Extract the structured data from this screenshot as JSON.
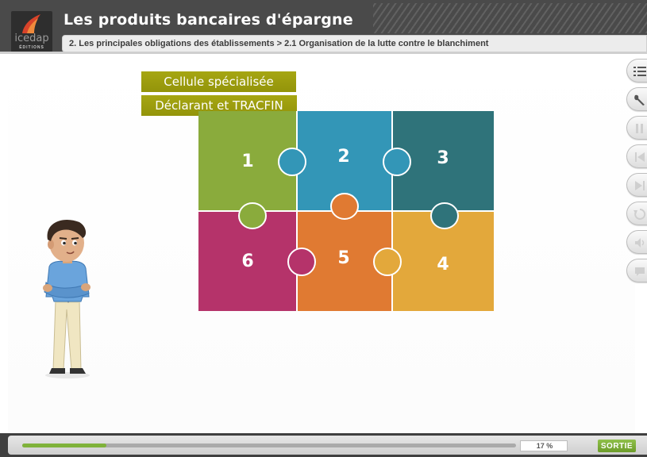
{
  "header": {
    "title": "Les produits bancaires d'épargne",
    "breadcrumb": "2. Les principales obligations des établissements > 2.1 Organisation de la lutte contre le blanchiment"
  },
  "logo": {
    "text": "icedap",
    "subtext": "ÉDITIONS"
  },
  "labels": [
    {
      "text": "Cellule spécialisée"
    },
    {
      "text": "Déclarant et TRACFIN"
    }
  ],
  "puzzle": {
    "pieces": [
      {
        "number": "1",
        "color": "#8aab3c"
      },
      {
        "number": "2",
        "color": "#3396b7"
      },
      {
        "number": "3",
        "color": "#2f737a"
      },
      {
        "number": "6",
        "color": "#b5336a"
      },
      {
        "number": "5",
        "color": "#e07a32"
      },
      {
        "number": "4",
        "color": "#e3a83b"
      }
    ]
  },
  "toolbar": {
    "items": [
      {
        "icon": "list-icon"
      },
      {
        "icon": "wrench-icon"
      },
      {
        "icon": "pause-icon"
      },
      {
        "icon": "skip-back-icon"
      },
      {
        "icon": "skip-forward-icon"
      },
      {
        "icon": "replay-icon"
      },
      {
        "icon": "audio-icon"
      },
      {
        "icon": "chat-icon"
      }
    ]
  },
  "footer": {
    "progress_text": "17 %",
    "progress_value": 0.17,
    "exit_label": "SORTIE"
  }
}
